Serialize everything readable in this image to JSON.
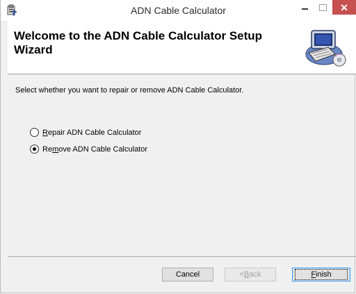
{
  "window": {
    "title": "ADN Cable Calculator",
    "minimize_glyph": "",
    "maximize_glyph": "",
    "close_glyph": "✕"
  },
  "header": {
    "title": "Welcome to the ADN Cable Calculator Setup Wizard"
  },
  "body": {
    "instruction": "Select whether you want to repair or remove ADN Cable Calculator.",
    "options": [
      {
        "label_prefix": "",
        "label_mnemonic": "R",
        "label_rest": "epair ADN Cable Calculator",
        "selected": false
      },
      {
        "label_prefix": "Re",
        "label_mnemonic": "m",
        "label_rest": "ove ADN Cable Calculator",
        "selected": true
      }
    ]
  },
  "footer": {
    "cancel_label": "Cancel",
    "back_prefix": "< ",
    "back_mnemonic": "B",
    "back_rest": "ack",
    "finish_mnemonic": "F",
    "finish_rest": "inish"
  },
  "colors": {
    "close_button": "#c75050",
    "focus_border": "#3399ff",
    "disabled_text": "#a0a0a0"
  },
  "icons": [
    "installer-icon",
    "computer-disc-icon"
  ]
}
